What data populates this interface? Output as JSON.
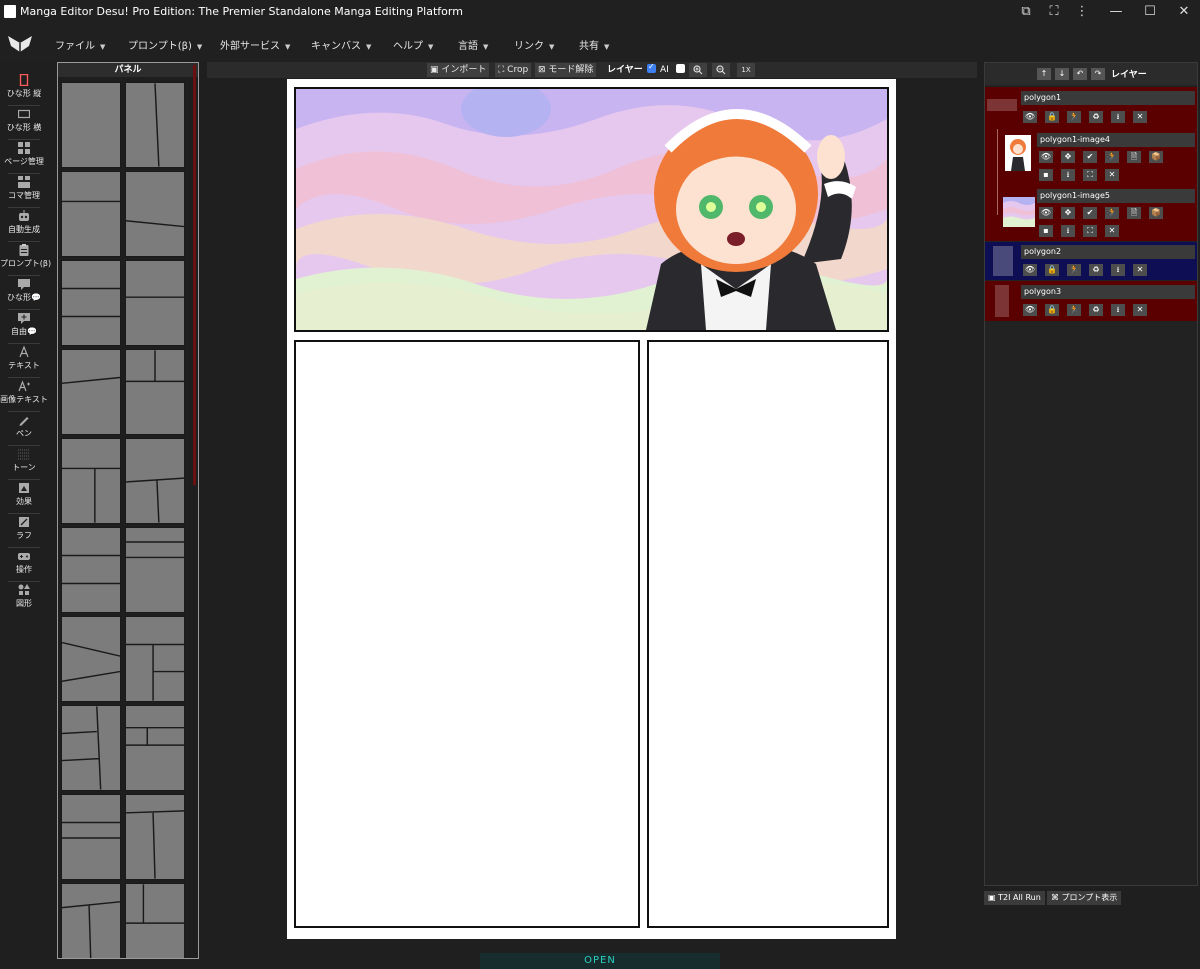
{
  "window": {
    "title": "Manga Editor Desu! Pro Edition: The Premier Standalone Manga Editing Platform",
    "controls": [
      "⧉",
      "⛶",
      "⋮",
      "—",
      "☐",
      "✕"
    ]
  },
  "menu": [
    {
      "label": "ファイル"
    },
    {
      "label": "プロンプト(β)"
    },
    {
      "label": "外部サービス"
    },
    {
      "label": "キャンバス"
    },
    {
      "label": "ヘルプ"
    },
    {
      "label": "言語"
    },
    {
      "label": "リンク"
    },
    {
      "label": "共有"
    }
  ],
  "toolbar": [
    {
      "label": "ひな形 縦",
      "icon": "portrait-page-icon",
      "active": true
    },
    {
      "label": "ひな形 横",
      "icon": "landscape-page-icon"
    },
    {
      "label": "ページ管理",
      "icon": "grid-icon"
    },
    {
      "label": "コマ管理",
      "icon": "panels-icon"
    },
    {
      "label": "自動生成",
      "icon": "robot-icon"
    },
    {
      "label": "プロンプト(β)",
      "icon": "clipboard-icon"
    },
    {
      "label": "ひな形💬",
      "icon": "speech-bubble-icon"
    },
    {
      "label": "自由💬",
      "icon": "add-bubble-icon"
    },
    {
      "label": "テキスト",
      "icon": "text-icon"
    },
    {
      "label": "画像テキスト",
      "icon": "image-text-icon"
    },
    {
      "label": "ペン",
      "icon": "pen-icon"
    },
    {
      "label": "トーン",
      "icon": "tone-icon"
    },
    {
      "label": "効果",
      "icon": "effect-icon"
    },
    {
      "label": "ラフ",
      "icon": "rough-icon"
    },
    {
      "label": "操作",
      "icon": "gamepad-icon"
    },
    {
      "label": "図形",
      "icon": "shapes-icon"
    }
  ],
  "panel_templates": {
    "header": "パネル"
  },
  "controls": {
    "import": "インポート",
    "crop": "Crop",
    "mode_release": "モード解除",
    "layer_label": "レイヤー",
    "ai_label": "AI",
    "ai_checked": true,
    "extra_checked": false,
    "zoom_in": "zoom-in-icon",
    "zoom_out": "zoom-out-icon",
    "one_x": "1X"
  },
  "layers_panel": {
    "title": "レイヤー",
    "buttons": [
      "↑",
      "↓",
      "↶",
      "↷"
    ],
    "layers": [
      {
        "name": "polygon1",
        "bg": "#5a0000",
        "icons": [
          "👁",
          "🔒",
          "🏃",
          "♻",
          "⭳",
          "✕"
        ]
      },
      {
        "name": "polygon1-image4",
        "bg": "#5a0000",
        "icons": [
          "👁",
          "✥",
          "✔",
          "🏃",
          "🗎",
          "📦",
          "▪",
          "⭳",
          "⛶",
          "✕"
        ]
      },
      {
        "name": "polygon1-image5",
        "bg": "#5a0000",
        "icons": [
          "👁",
          "✥",
          "✔",
          "🏃",
          "🗎",
          "📦",
          "▪",
          "⭳",
          "⛶",
          "✕"
        ]
      },
      {
        "name": "polygon2",
        "bg": "#0e0e55",
        "icons": [
          "👁",
          "🔒",
          "🏃",
          "♻",
          "⭳",
          "✕"
        ]
      },
      {
        "name": "polygon3",
        "bg": "#5a0000",
        "icons": [
          "👁",
          "🔒",
          "🏃",
          "♻",
          "⭳",
          "✕"
        ]
      }
    ],
    "footer": {
      "t2i_all_run": "T2I All Run",
      "show_prompt": "プロンプト表示"
    }
  },
  "status": {
    "open": "OPEN"
  },
  "colors": {
    "accent_open": "#2bd0c0",
    "layer_selected": "#0e0e55",
    "layer_default": "#5a0000"
  }
}
